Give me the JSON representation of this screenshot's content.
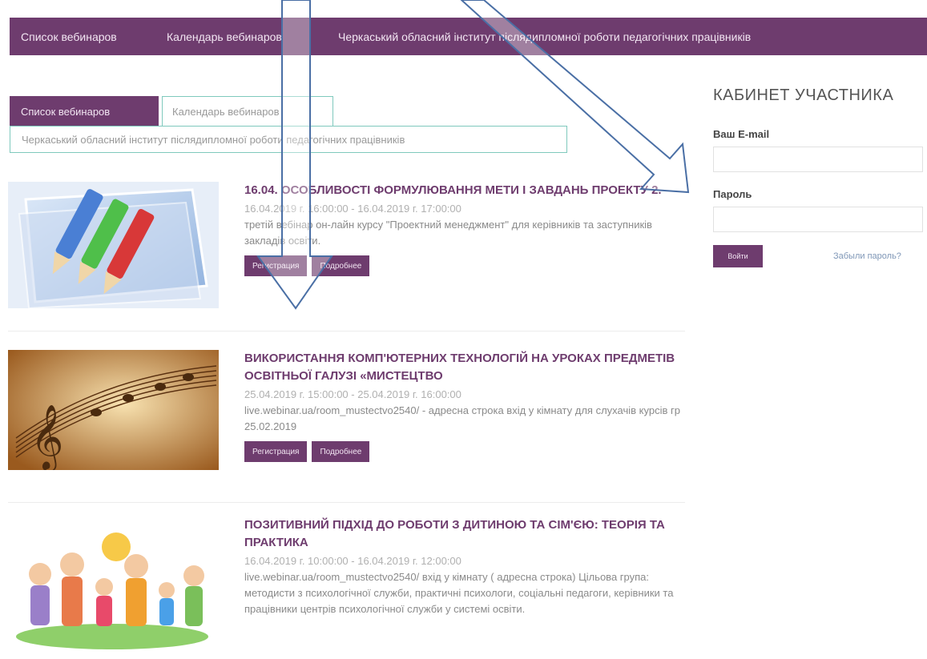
{
  "topnav": {
    "items": [
      {
        "label": "Список вебинаров"
      },
      {
        "label": "Календарь вебинаров"
      },
      {
        "label": "Черкаський обласний інститут післядипломної роботи педагогічних працівників"
      }
    ]
  },
  "tabs": [
    {
      "label": "Список вебинаров",
      "active": true
    },
    {
      "label": "Календарь вебинаров",
      "active": false
    },
    {
      "label": "Черкаський обласний інститут післядипломної роботи педагогічних працівників",
      "active": false
    }
  ],
  "webinars": [
    {
      "title": "16.04. ОСОБЛИВОСТІ ФОРМУЛЮВАННЯ МЕТИ І ЗАВДАНЬ ПРОЕКТУ 2.",
      "date": "16.04.2019 г. 16:00:00 - 16.04.2019 г. 17:00:00",
      "description": "третій вебінар он-лайн курсу \"Проектний менеджмент\" для керівників та заступників закладів освіти.",
      "register_label": "Регистрация",
      "details_label": "Подробнее",
      "thumb_icon": "pencils-image"
    },
    {
      "title": "ВИКОРИСТАННЯ КОМП'ЮТЕРНИХ ТЕХНОЛОГІЙ НА УРОКАХ ПРЕДМЕТІВ ОСВІТНЬОЇ ГАЛУЗІ «МИСТЕЦТВО",
      "date": "25.04.2019 г. 15:00:00 - 25.04.2019 г. 16:00:00",
      "description": "live.webinar.ua/room_mustectvo2540/ - адресна строка вхід у кімнату для слухачів курсів гр 25.02.2019",
      "register_label": "Регистрация",
      "details_label": "Подробнее",
      "thumb_icon": "music-notes-image"
    },
    {
      "title": "ПОЗИТИВНИЙ ПІДХІД ДО РОБОТИ З ДИТИНОЮ ТА СІМ'ЄЮ: ТЕОРІЯ ТА ПРАКТИКА",
      "date": "16.04.2019 г. 10:00:00 - 16.04.2019 г. 12:00:00",
      "description": "live.webinar.ua/room_mustectvo2540/ вхід у кімнату ( адресна строка) Цільова група: методисти з психологічної служби, практичні психологи, соціальні педагоги, керівники та працівники центрів психологічної служби у системі освіти.",
      "thumb_icon": "family-cartoon-image"
    }
  ],
  "sidebar": {
    "title": "КАБИНЕТ УЧАСТНИКА",
    "email_label": "Ваш E-mail",
    "email_value": "",
    "password_label": "Пароль",
    "password_value": "",
    "login_label": "Войти",
    "forgot_label": "Забыли пароль?"
  },
  "colors": {
    "brand": "#6e3c6e",
    "tab_border": "#7fc9bd",
    "annotation_arrow": "#4a6fa5"
  }
}
